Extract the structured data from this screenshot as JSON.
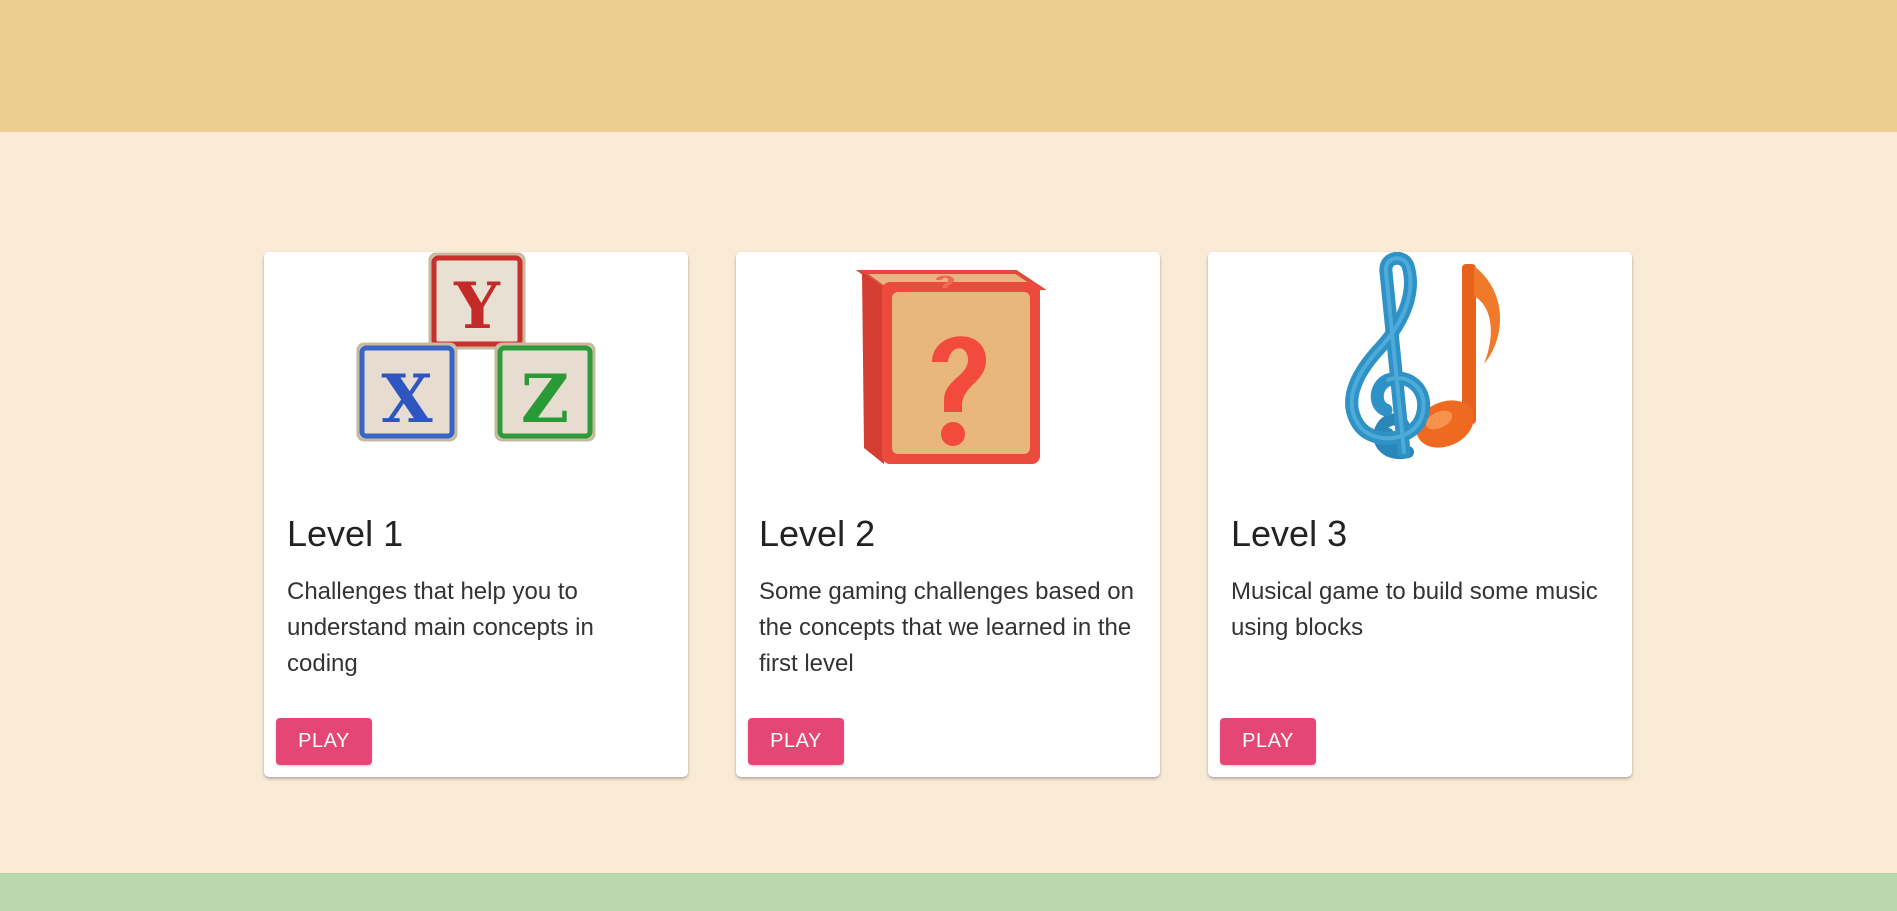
{
  "header": {},
  "levels": [
    {
      "title": "Level 1",
      "description": "Challenges that help you to understand main concepts in coding",
      "button_label": "PLAY",
      "image": "xyz-blocks"
    },
    {
      "title": "Level 2",
      "description": "Some gaming challenges based on the concepts that we learned in the first level",
      "button_label": "PLAY",
      "image": "question-mark-block"
    },
    {
      "title": "Level 3",
      "description": "Musical game to build some music using blocks",
      "button_label": "PLAY",
      "image": "music-notes"
    }
  ],
  "block_letters": [
    "Y",
    "X",
    "Z"
  ],
  "colors": {
    "header": "#ebcd8f",
    "background": "#faebd7",
    "footer": "#bad8ae",
    "play_button": "#e44776",
    "card": "#ffffff"
  }
}
